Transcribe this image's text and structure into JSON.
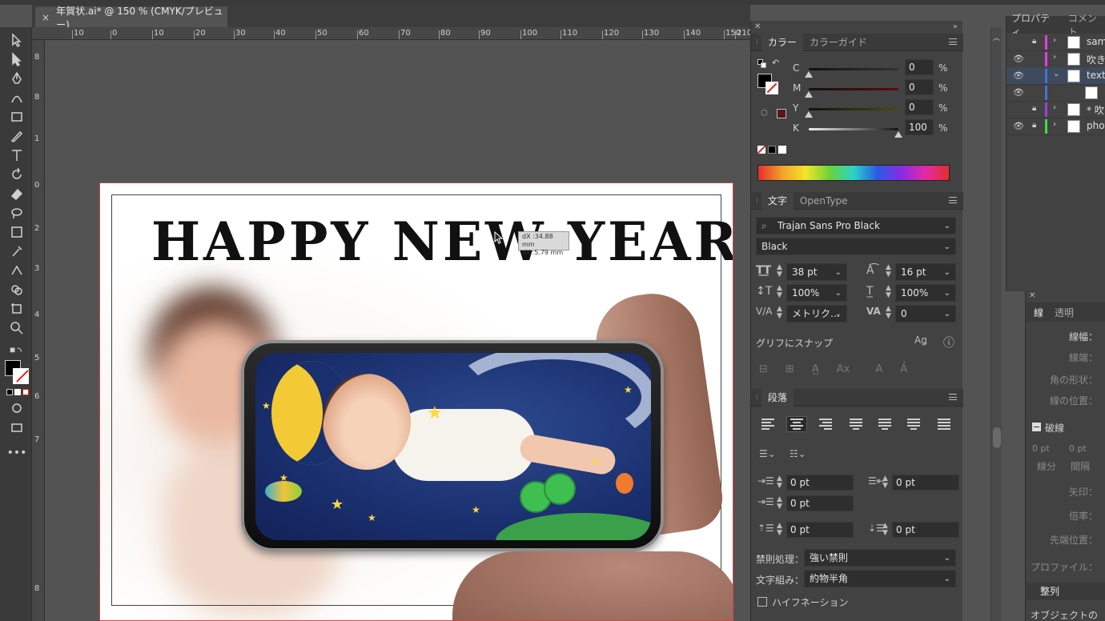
{
  "document_tab": {
    "close": "×",
    "title": "年賀状.ai* @ 150 % (CMYK/プレビュー)"
  },
  "ruler": {
    "top_ticks": [
      "10",
      "0",
      "10",
      "20",
      "30",
      "40",
      "50",
      "60",
      "70",
      "80",
      "90",
      "100",
      "110",
      "120",
      "130",
      "140",
      "150",
      "210"
    ],
    "left_ticks": [
      "8",
      "8",
      "1",
      "0",
      "2",
      "3",
      "4",
      "5",
      "6",
      "7",
      "8"
    ]
  },
  "artwork": {
    "headline": "HAPPY NEW YEAR",
    "move_tooltip": {
      "dx": "dX :34.88 mm",
      "dy": "dY :5.79 mm"
    }
  },
  "color_panel": {
    "tabs": [
      "カラー",
      "カラーガイド"
    ],
    "channels": [
      {
        "label": "C",
        "value": "0",
        "unit": "%",
        "level": 0
      },
      {
        "label": "M",
        "value": "0",
        "unit": "%",
        "level": 0
      },
      {
        "label": "Y",
        "value": "0",
        "unit": "%",
        "level": 0
      },
      {
        "label": "K",
        "value": "100",
        "unit": "%",
        "level": 100
      }
    ],
    "colors": {
      "fill": "#000000",
      "cmyk_swatch": "#5a1414"
    }
  },
  "character_panel": {
    "tabs": [
      "文字",
      "OpenType"
    ],
    "font_family": "Trajan Sans Pro Black",
    "font_style": "Black",
    "font_size": "38 pt",
    "leading": "16 pt",
    "vertical_scale": "100%",
    "horizontal_scale": "100%",
    "kerning": "メトリク…",
    "tracking": "0",
    "snap_label": "グリフにスナップ"
  },
  "paragraph_panel": {
    "tab": "段落",
    "indent_left": "0 pt",
    "indent_right": "0 pt",
    "indent_first": "0 pt",
    "space_before": "0 pt",
    "space_after": "0 pt",
    "kinsoku_label": "禁則処理：",
    "kinsoku_value": "強い禁則",
    "mojikumi_label": "文字組み：",
    "mojikumi_value": "約物半角",
    "hyphenation_label": "ハイフネーション"
  },
  "right_tabs": [
    "プロパティ",
    "コメント"
  ],
  "layers": [
    {
      "name": "sam",
      "eye": false,
      "lock": true,
      "color": "#e040e0",
      "expanded": false
    },
    {
      "name": "吹き",
      "eye": true,
      "lock": false,
      "color": "#e040e0",
      "expanded": false
    },
    {
      "name": "text",
      "eye": true,
      "lock": false,
      "color": "#4a6fd6",
      "expanded": true,
      "selected": true
    },
    {
      "name": "",
      "eye": true,
      "lock": false,
      "color": "#4a6fd6",
      "expanded": false
    },
    {
      "name": "* 吹き",
      "eye": false,
      "lock": true,
      "color": "#9a40e0",
      "expanded": false
    },
    {
      "name": "phot",
      "eye": true,
      "lock": true,
      "color": "#40e040",
      "expanded": false
    }
  ],
  "stroke_panel": {
    "tabs": [
      "線",
      "透明"
    ],
    "weight_label": "線幅：",
    "cap_label": "線端：",
    "corner_label": "角の形状：",
    "align_label": "線の位置：",
    "dashed_label": "破線",
    "dash_labels": [
      "0 pt",
      "0 pt"
    ],
    "dash_sub": [
      "線分",
      "間隔"
    ],
    "arrow_label": "矢印：",
    "scale_label": "倍率：",
    "tip_label": "先端位置：",
    "profile_label": "プロファイル：",
    "align_panel": "整列",
    "align_obj": "オブジェクトの整"
  }
}
